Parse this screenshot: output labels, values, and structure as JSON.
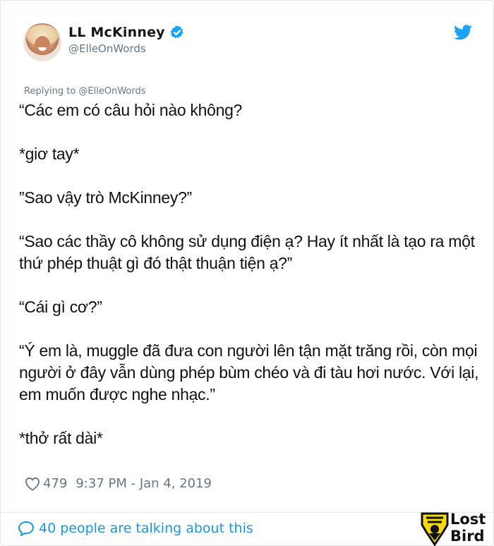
{
  "author": {
    "name": "LL McKinney",
    "handle": "@ElleOnWords",
    "verified": true
  },
  "replying_to": "Replying to @ElleOnWords",
  "tweet_paragraphs": [
    "“Các em có câu hỏi nào không?",
    "*giơ tay*",
    "”Sao vậy trò McKinney?”",
    "“Sao các thầy cô không sử dụng điện ạ? Hay ít nhất là tạo ra một thứ phép thuật gì đó thật thuận tiện ạ?”",
    "“Cái gì cơ?”",
    "“Ý em là, muggle đã đưa con người lên tận mặt trăng rồi, còn mọi người ở đây vẫn dùng phép bùm chéo và đi tàu hơi nước. Với lại, em muốn được nghe nhạc.”",
    "*thở rất dài*"
  ],
  "stats": {
    "likes": "479",
    "timestamp": "9:37 PM - Jan 4, 2019"
  },
  "footer": {
    "talking": "40 people are talking about this"
  },
  "watermark": {
    "line1": "Lost",
    "line2": "Bird"
  },
  "colors": {
    "accent": "#1da1f2",
    "link": "#1b95e0",
    "muted": "#657786",
    "logo_yellow": "#f5d90a"
  },
  "icons": {
    "verified": "verified-badge-icon",
    "bird": "twitter-bird-icon",
    "like": "heart-outline-icon",
    "talk": "speech-bubble-icon"
  }
}
